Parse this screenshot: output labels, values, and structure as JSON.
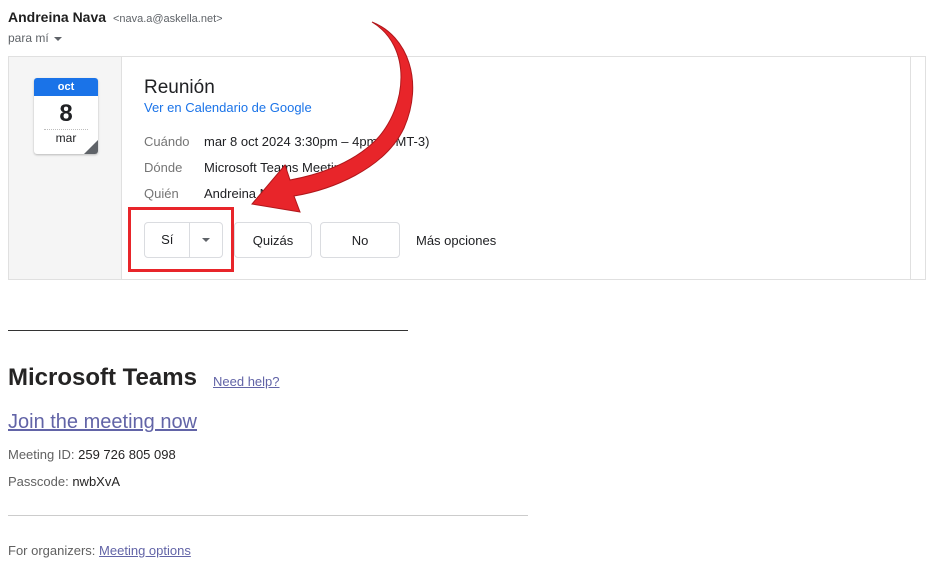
{
  "sender": {
    "name": "Andreina Nava",
    "email": "<nava.a@askella.net>",
    "recipient": "para mí"
  },
  "invite": {
    "calendar": {
      "month": "oct",
      "day": "8",
      "weekday": "mar"
    },
    "title": "Reunión",
    "calendar_link": "Ver en Calendario de Google",
    "details": [
      {
        "label": "Cuándo",
        "value": "mar 8 oct 2024 3:30pm – 4pm (GMT-3)"
      },
      {
        "label": "Dónde",
        "value": "Microsoft Teams Meeting"
      },
      {
        "label": "Quién",
        "value": "Andreina Nava"
      }
    ],
    "buttons": {
      "yes": "Sí",
      "maybe": "Quizás",
      "no": "No",
      "more": "Más opciones"
    }
  },
  "teams": {
    "title": "Microsoft Teams",
    "help_link": "Need help?",
    "join_link": "Join the meeting now",
    "meeting_id_label": "Meeting ID:",
    "meeting_id": "259 726 805 098",
    "passcode_label": "Passcode:",
    "passcode": "nwbXvA",
    "organizers_label": "For organizers:",
    "organizers_link": "Meeting options"
  },
  "colors": {
    "highlight": "#e8252a",
    "calendar_blue": "#1a73e8",
    "teams_link": "#6264a7"
  }
}
